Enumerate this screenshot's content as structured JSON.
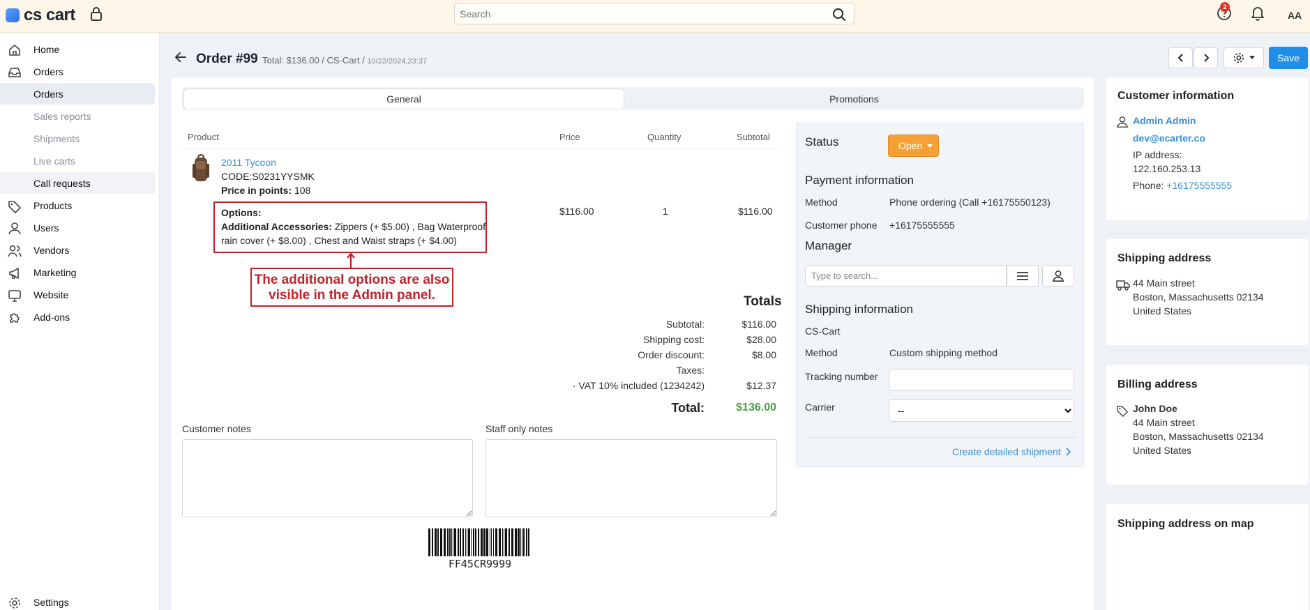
{
  "topbar": {
    "logo_text": "cs cart",
    "search_placeholder": "Search",
    "notification_badge": "2",
    "avatar_initials": "AA"
  },
  "sidebar": {
    "home": "Home",
    "orders": "Orders",
    "orders_sub": [
      "Orders",
      "Sales reports",
      "Shipments",
      "Live carts",
      "Call requests"
    ],
    "products": "Products",
    "users": "Users",
    "vendors": "Vendors",
    "marketing": "Marketing",
    "website": "Website",
    "addons": "Add-ons",
    "settings": "Settings"
  },
  "header": {
    "title": "Order #99",
    "meta": "Total: $136.00 / CS-Cart /",
    "date": "10/22/2024,23:37",
    "save_label": "Save"
  },
  "tabs": {
    "general": "General",
    "promotions": "Promotions"
  },
  "table": {
    "headers": {
      "product": "Product",
      "price": "Price",
      "quantity": "Quantity",
      "subtotal": "Subtotal"
    },
    "row": {
      "name": "2011 Tycoon",
      "code": "CODE:S0231YYSMK",
      "points_label": "Price in points:",
      "points_value": "108",
      "options_label": "Options:",
      "accessories_label": "Additional Accessories:",
      "accessories_value": "Zippers (+ $5.00) , Bag Waterproof rain cover (+ $8.00) , Chest and Waist straps (+ $4.00)",
      "price": "$116.00",
      "quantity": "1",
      "subtotal": "$116.00"
    }
  },
  "annotation": {
    "line1": "The additional options are also",
    "line2": "visible in the Admin panel."
  },
  "totals": {
    "title": "Totals",
    "rows": [
      {
        "label": "Subtotal:",
        "value": "$116.00"
      },
      {
        "label": "Shipping cost:",
        "value": "$28.00"
      },
      {
        "label": "Order discount:",
        "value": "$8.00"
      },
      {
        "label": "Taxes:",
        "value": ""
      },
      {
        "label": "· VAT 10% included (1234242)",
        "value": "$12.37"
      }
    ],
    "total_label": "Total:",
    "total_value": "$136.00"
  },
  "notes": {
    "customer_label": "Customer notes",
    "staff_label": "Staff only notes"
  },
  "barcode_text": "FF45CR9999",
  "status_panel": {
    "status_label": "Status",
    "status_value": "Open",
    "payment_title": "Payment information",
    "method_label": "Method",
    "method_value": "Phone ordering (Call +16175550123)",
    "phone_label": "Customer phone",
    "phone_value": "+16175555555",
    "manager_title": "Manager",
    "manager_placeholder": "Type to search...",
    "shipping_title": "Shipping information",
    "shipping_store": "CS-Cart",
    "shipping_method_label": "Method",
    "shipping_method_value": "Custom shipping method",
    "tracking_label": "Tracking number",
    "carrier_label": "Carrier",
    "carrier_value": "--",
    "create_link": "Create detailed shipment"
  },
  "customer": {
    "title": "Customer information",
    "name": "Admin Admin",
    "email": "dev@ecarter.co",
    "ip_label": "IP address:",
    "ip_value": "122.160.253.13",
    "phone_label": "Phone:",
    "phone_value": "+16175555555"
  },
  "shipping_address": {
    "title": "Shipping address",
    "line1": "44 Main street",
    "line2": "Boston, Massachusetts 02134",
    "line3": "United States"
  },
  "billing_address": {
    "title": "Billing address",
    "name": "John Doe",
    "line1": "44 Main street",
    "line2": "Boston, Massachusetts 02134",
    "line3": "United States"
  },
  "map": {
    "title": "Shipping address on map"
  },
  "colors": {
    "accent": "#1f8eea",
    "status_open": "#f6a136",
    "annotation_red": "#c51f2a",
    "total_green": "#47a13c",
    "link": "#3a8fd6"
  }
}
